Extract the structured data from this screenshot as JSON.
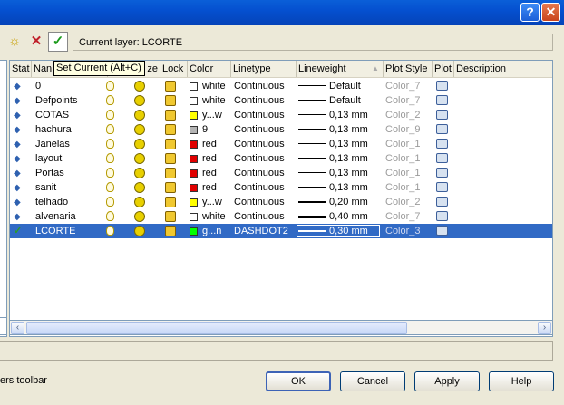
{
  "window": {
    "help_glyph": "?",
    "close_glyph": "✕"
  },
  "toolbar": {
    "new_icon": "☼",
    "delete_icon": "✕",
    "set_current_icon": "✓",
    "current_layer": "Current layer: LCORTE"
  },
  "tooltip": "Set Current (Alt+C)",
  "columns": {
    "stat": "Stat",
    "name": "Nan",
    "freeze": "ze",
    "lock": "Lock",
    "color": "Color",
    "linetype": "Linetype",
    "lineweight": "Lineweight",
    "sort_arrow": "▲",
    "plot_style": "Plot Style",
    "plot": "Plot",
    "description": "Description"
  },
  "layers": [
    {
      "name": "0",
      "swatch": "#ffffff",
      "color": "white",
      "linetype": "Continuous",
      "lineweight": "Default",
      "plot_style": "Color_7"
    },
    {
      "name": "Defpoints",
      "swatch": "#ffffff",
      "color": "white",
      "linetype": "Continuous",
      "lineweight": "Default",
      "plot_style": "Color_7"
    },
    {
      "name": "COTAS",
      "swatch": "#ffff00",
      "color": "y...w",
      "linetype": "Continuous",
      "lineweight": "0,13 mm",
      "plot_style": "Color_2"
    },
    {
      "name": "hachura",
      "swatch": "#b4b4b4",
      "color": "9",
      "linetype": "Continuous",
      "lineweight": "0,13 mm",
      "plot_style": "Color_9"
    },
    {
      "name": "Janelas",
      "swatch": "#e00000",
      "color": "red",
      "linetype": "Continuous",
      "lineweight": "0,13 mm",
      "plot_style": "Color_1"
    },
    {
      "name": "layout",
      "swatch": "#e00000",
      "color": "red",
      "linetype": "Continuous",
      "lineweight": "0,13 mm",
      "plot_style": "Color_1"
    },
    {
      "name": "Portas",
      "swatch": "#e00000",
      "color": "red",
      "linetype": "Continuous",
      "lineweight": "0,13 mm",
      "plot_style": "Color_1"
    },
    {
      "name": "sanit",
      "swatch": "#e00000",
      "color": "red",
      "linetype": "Continuous",
      "lineweight": "0,13 mm",
      "plot_style": "Color_1"
    },
    {
      "name": "telhado",
      "swatch": "#ffff00",
      "color": "y...w",
      "linetype": "Continuous",
      "lineweight": "0,20 mm",
      "plot_style": "Color_2"
    },
    {
      "name": "alvenaria",
      "swatch": "#ffffff",
      "color": "white",
      "linetype": "Continuous",
      "lineweight": "0,40 mm",
      "plot_style": "Color_7"
    },
    {
      "name": "LCORTE",
      "swatch": "#00ff00",
      "color": "g...n",
      "linetype": "DASHDOT2",
      "lineweight": "0,30 mm",
      "plot_style": "Color_3",
      "current": true
    }
  ],
  "scrollbar": {
    "left_arrow": "‹",
    "right_arrow": "›"
  },
  "footer": {
    "status_text": "ers toolbar"
  },
  "buttons": {
    "ok": "OK",
    "cancel": "Cancel",
    "apply": "Apply",
    "help": "Help"
  }
}
